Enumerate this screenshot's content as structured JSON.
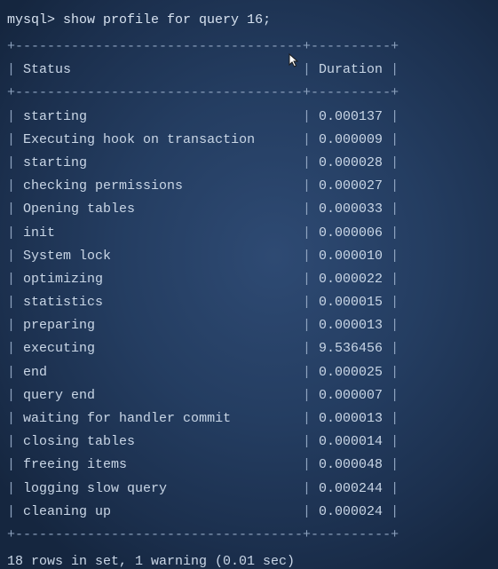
{
  "terminal": {
    "prompt": "mysql>",
    "command": "show profile for query 16;",
    "border_line": "+------------------------------------+----------+",
    "header": {
      "status": "Status",
      "duration": "Duration"
    },
    "rows": [
      {
        "status": "starting",
        "duration": "0.000137"
      },
      {
        "status": "Executing hook on transaction",
        "duration": "0.000009"
      },
      {
        "status": "starting",
        "duration": "0.000028"
      },
      {
        "status": "checking permissions",
        "duration": "0.000027"
      },
      {
        "status": "Opening tables",
        "duration": "0.000033"
      },
      {
        "status": "init",
        "duration": "0.000006"
      },
      {
        "status": "System lock",
        "duration": "0.000010"
      },
      {
        "status": "optimizing",
        "duration": "0.000022"
      },
      {
        "status": "statistics",
        "duration": "0.000015"
      },
      {
        "status": "preparing",
        "duration": "0.000013"
      },
      {
        "status": "executing",
        "duration": "9.536456"
      },
      {
        "status": "end",
        "duration": "0.000025"
      },
      {
        "status": "query end",
        "duration": "0.000007"
      },
      {
        "status": "waiting for handler commit",
        "duration": "0.000013"
      },
      {
        "status": "closing tables",
        "duration": "0.000014"
      },
      {
        "status": "freeing items",
        "duration": "0.000048"
      },
      {
        "status": "logging slow query",
        "duration": "0.000244"
      },
      {
        "status": "cleaning up",
        "duration": "0.000024"
      }
    ],
    "summary": "18 rows in set, 1 warning (0.01 sec)"
  },
  "colors": {
    "background": "#243d61",
    "text": "#c9d6e6",
    "border": "#8ea3bf"
  },
  "icons": {
    "cursor": "mouse-pointer-icon"
  }
}
